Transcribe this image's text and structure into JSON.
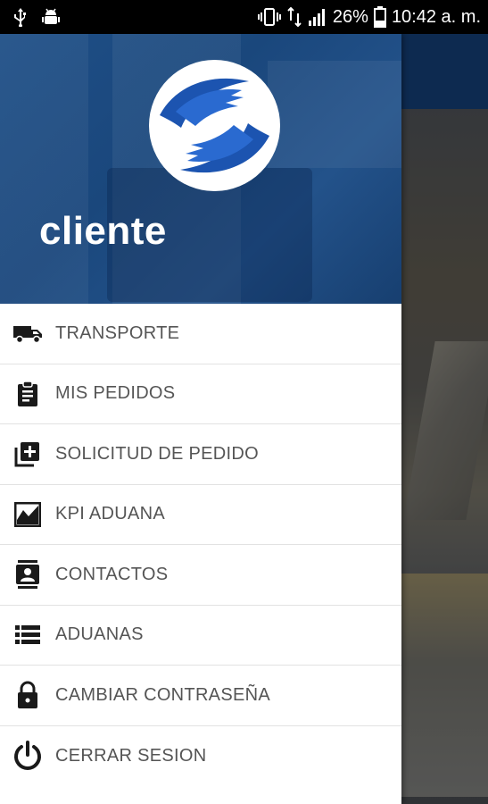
{
  "status_bar": {
    "left_icons": [
      "usb-icon",
      "android-debug-icon"
    ],
    "right_icons": [
      "vibrate-icon",
      "data-transfer-icon",
      "signal-icon",
      "battery-icon"
    ],
    "battery": "26%",
    "time": "10:42 a. m."
  },
  "drawer": {
    "title": "cliente",
    "brand_color": "#1a4a84",
    "items": [
      {
        "label": "TRANSPORTE",
        "icon": "truck-icon"
      },
      {
        "label": "MIS PEDIDOS",
        "icon": "clipboard-icon"
      },
      {
        "label": "SOLICITUD DE PEDIDO",
        "icon": "add-to-queue-icon"
      },
      {
        "label": "KPI ADUANA",
        "icon": "chart-icon"
      },
      {
        "label": "CONTACTOS",
        "icon": "contacts-icon"
      },
      {
        "label": "ADUANAS",
        "icon": "list-icon"
      },
      {
        "label": "CAMBIAR CONTRASEÑA",
        "icon": "lock-icon"
      },
      {
        "label": "CERRAR SESION",
        "icon": "power-icon"
      }
    ]
  }
}
